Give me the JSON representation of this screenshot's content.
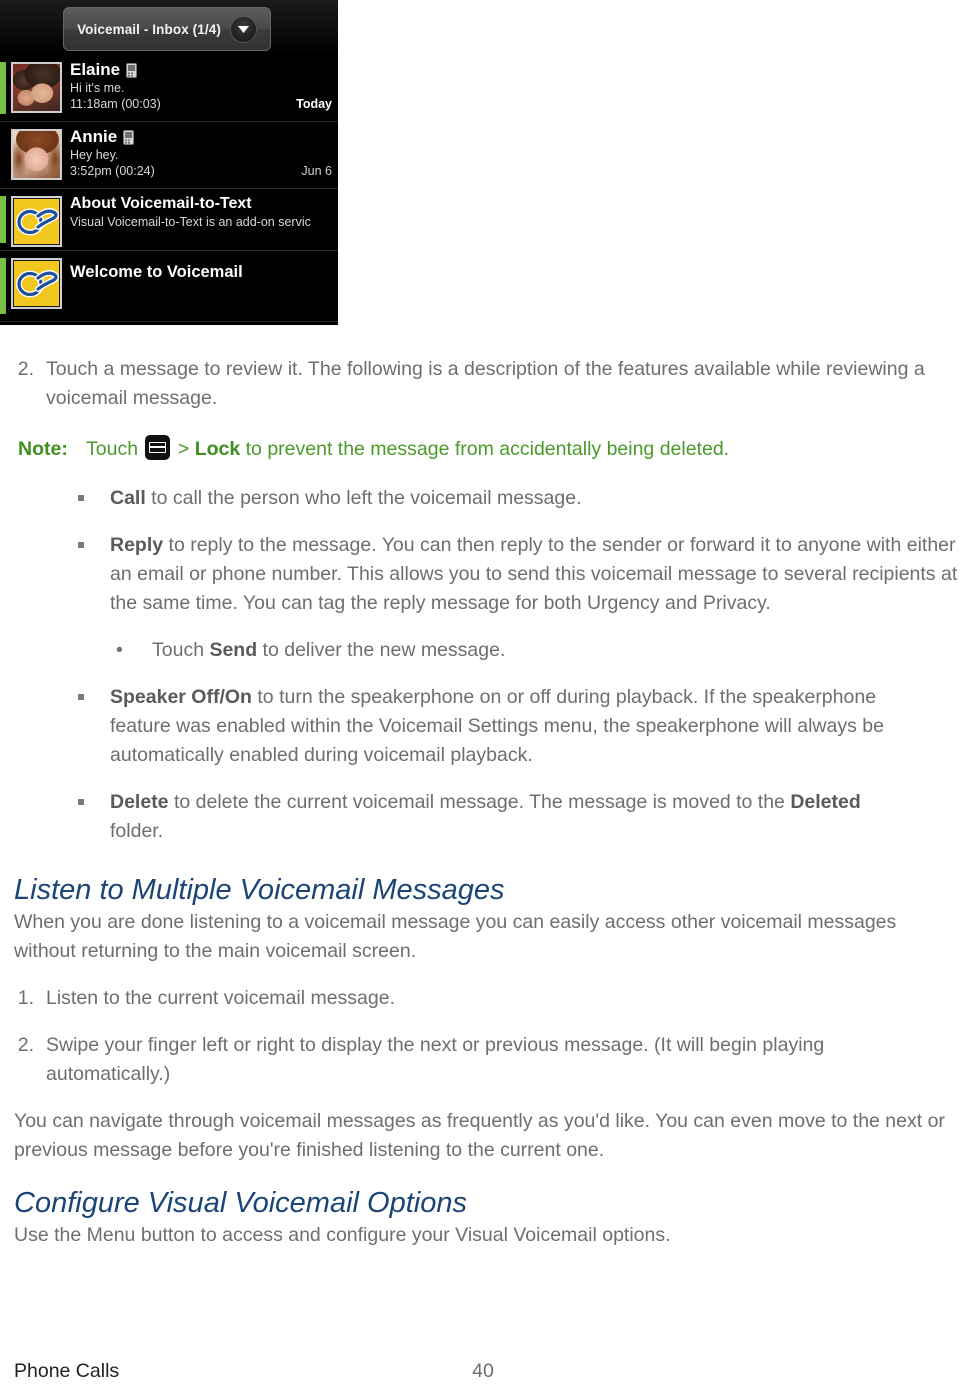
{
  "screenshot": {
    "app_title": "Voicemail - Inbox (1/4)",
    "dropdown_icon": "chevron-down-icon",
    "messages": [
      {
        "name": "Elaine",
        "preview": "Hi it's me.",
        "time": "11:18am (00:03)",
        "date": "Today",
        "unread": true,
        "avatar": "photo-elaine",
        "device_icon": "mobile-phone-icon"
      },
      {
        "name": "Annie",
        "preview": "Hey hey.",
        "time": "3:52pm (00:24)",
        "date": "Jun 6",
        "unread": false,
        "avatar": "photo-annie",
        "device_icon": "mobile-phone-icon"
      },
      {
        "name": "About Voicemail-to-Text",
        "preview": "Visual Voicemail-to-Text is an add-on servic",
        "time": "",
        "date": "",
        "unread": true,
        "avatar": "voicemail-logo-icon",
        "device_icon": ""
      },
      {
        "name": "Welcome to Voicemail",
        "preview": "",
        "time": "",
        "date": "",
        "unread": true,
        "avatar": "voicemail-logo-icon",
        "device_icon": ""
      }
    ]
  },
  "colors": {
    "heading": "#1b4477",
    "body": "#6e6e6e",
    "note_green": "#4a9a2a",
    "unread_green": "#76c043"
  },
  "doc": {
    "step2": {
      "num": "2.",
      "text_1": "Touch a message to review it. The following is a description of the features available while reviewing a voicemail message."
    },
    "note": {
      "label": "Note:",
      "pre": "Touch",
      "icon": "menu-icon",
      "mid": "> ",
      "bold": "Lock",
      "post": " to prevent the message from accidentally being deleted."
    },
    "features": [
      {
        "bold": "Call",
        "text": " to call the person who left the voicemail message."
      },
      {
        "bold": "Reply",
        "text": " to reply to the message. You can then reply to the sender or forward it to anyone with either an email or phone number. This allows you to send this voicemail message to several recipients at the same time. You can tag the reply message for both Urgency and Privacy."
      },
      {
        "bold": "Speaker Off/On",
        "text": " to turn the speakerphone on or off during playback. If the speakerphone feature was enabled within the Voicemail Settings menu, the speakerphone will always be automatically enabled during voicemail playback."
      },
      {
        "bold": "Delete",
        "text_a": " to delete the current voicemail message. The message is moved to the ",
        "bold_b": "Deleted",
        "text_b": " folder."
      }
    ],
    "send_subbullet": {
      "mark": "•",
      "pre": "Touch ",
      "bold": "Send",
      "post": " to deliver the new message."
    },
    "section_listen": {
      "heading": "Listen to Multiple Voicemail Messages",
      "intro": "When you are done listening to a voicemail message you can easily access other voicemail messages without returning to the main voicemail screen.",
      "steps": [
        {
          "num": "1.",
          "text": "Listen to the current voicemail message."
        },
        {
          "num": "2.",
          "text": "Swipe your finger left or right to display the next or previous message. (It will begin playing automatically.)"
        }
      ],
      "outro": "You can navigate through voicemail messages as frequently as you'd like. You can even move to the next or previous message before you're finished listening to the current one."
    },
    "section_configure": {
      "heading": "Configure Visual Voicemail Options",
      "intro": "Use the Menu button to access and configure your Visual Voicemail options."
    }
  },
  "footer": {
    "left": "Phone Calls",
    "page": "40"
  }
}
